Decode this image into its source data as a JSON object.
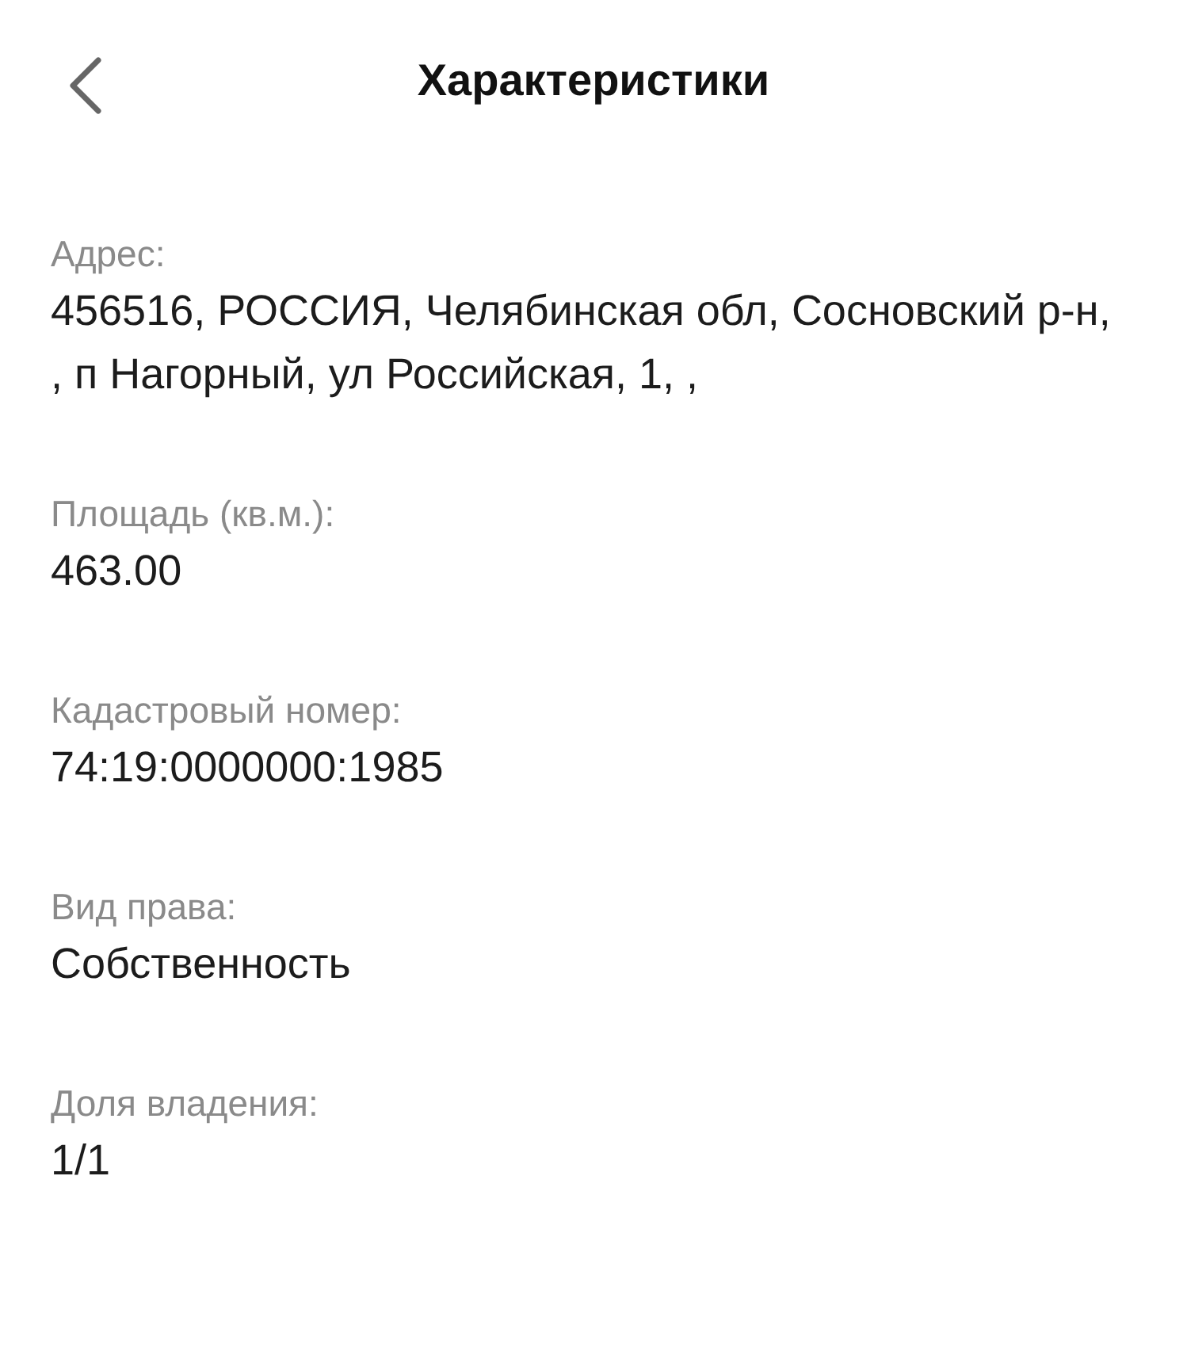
{
  "header": {
    "title": "Характеристики"
  },
  "fields": [
    {
      "label": "Адрес:",
      "value": "456516, РОССИЯ, Челябинская обл, Сосновский р-н, , п Нагорный, ул Российская, 1, ,"
    },
    {
      "label": "Площадь (кв.м.):",
      "value": "463.00"
    },
    {
      "label": "Кадастровый номер:",
      "value": "74:19:0000000:1985"
    },
    {
      "label": "Вид права:",
      "value": "Собственность"
    },
    {
      "label": "Доля владения:",
      "value": "1/1"
    }
  ]
}
